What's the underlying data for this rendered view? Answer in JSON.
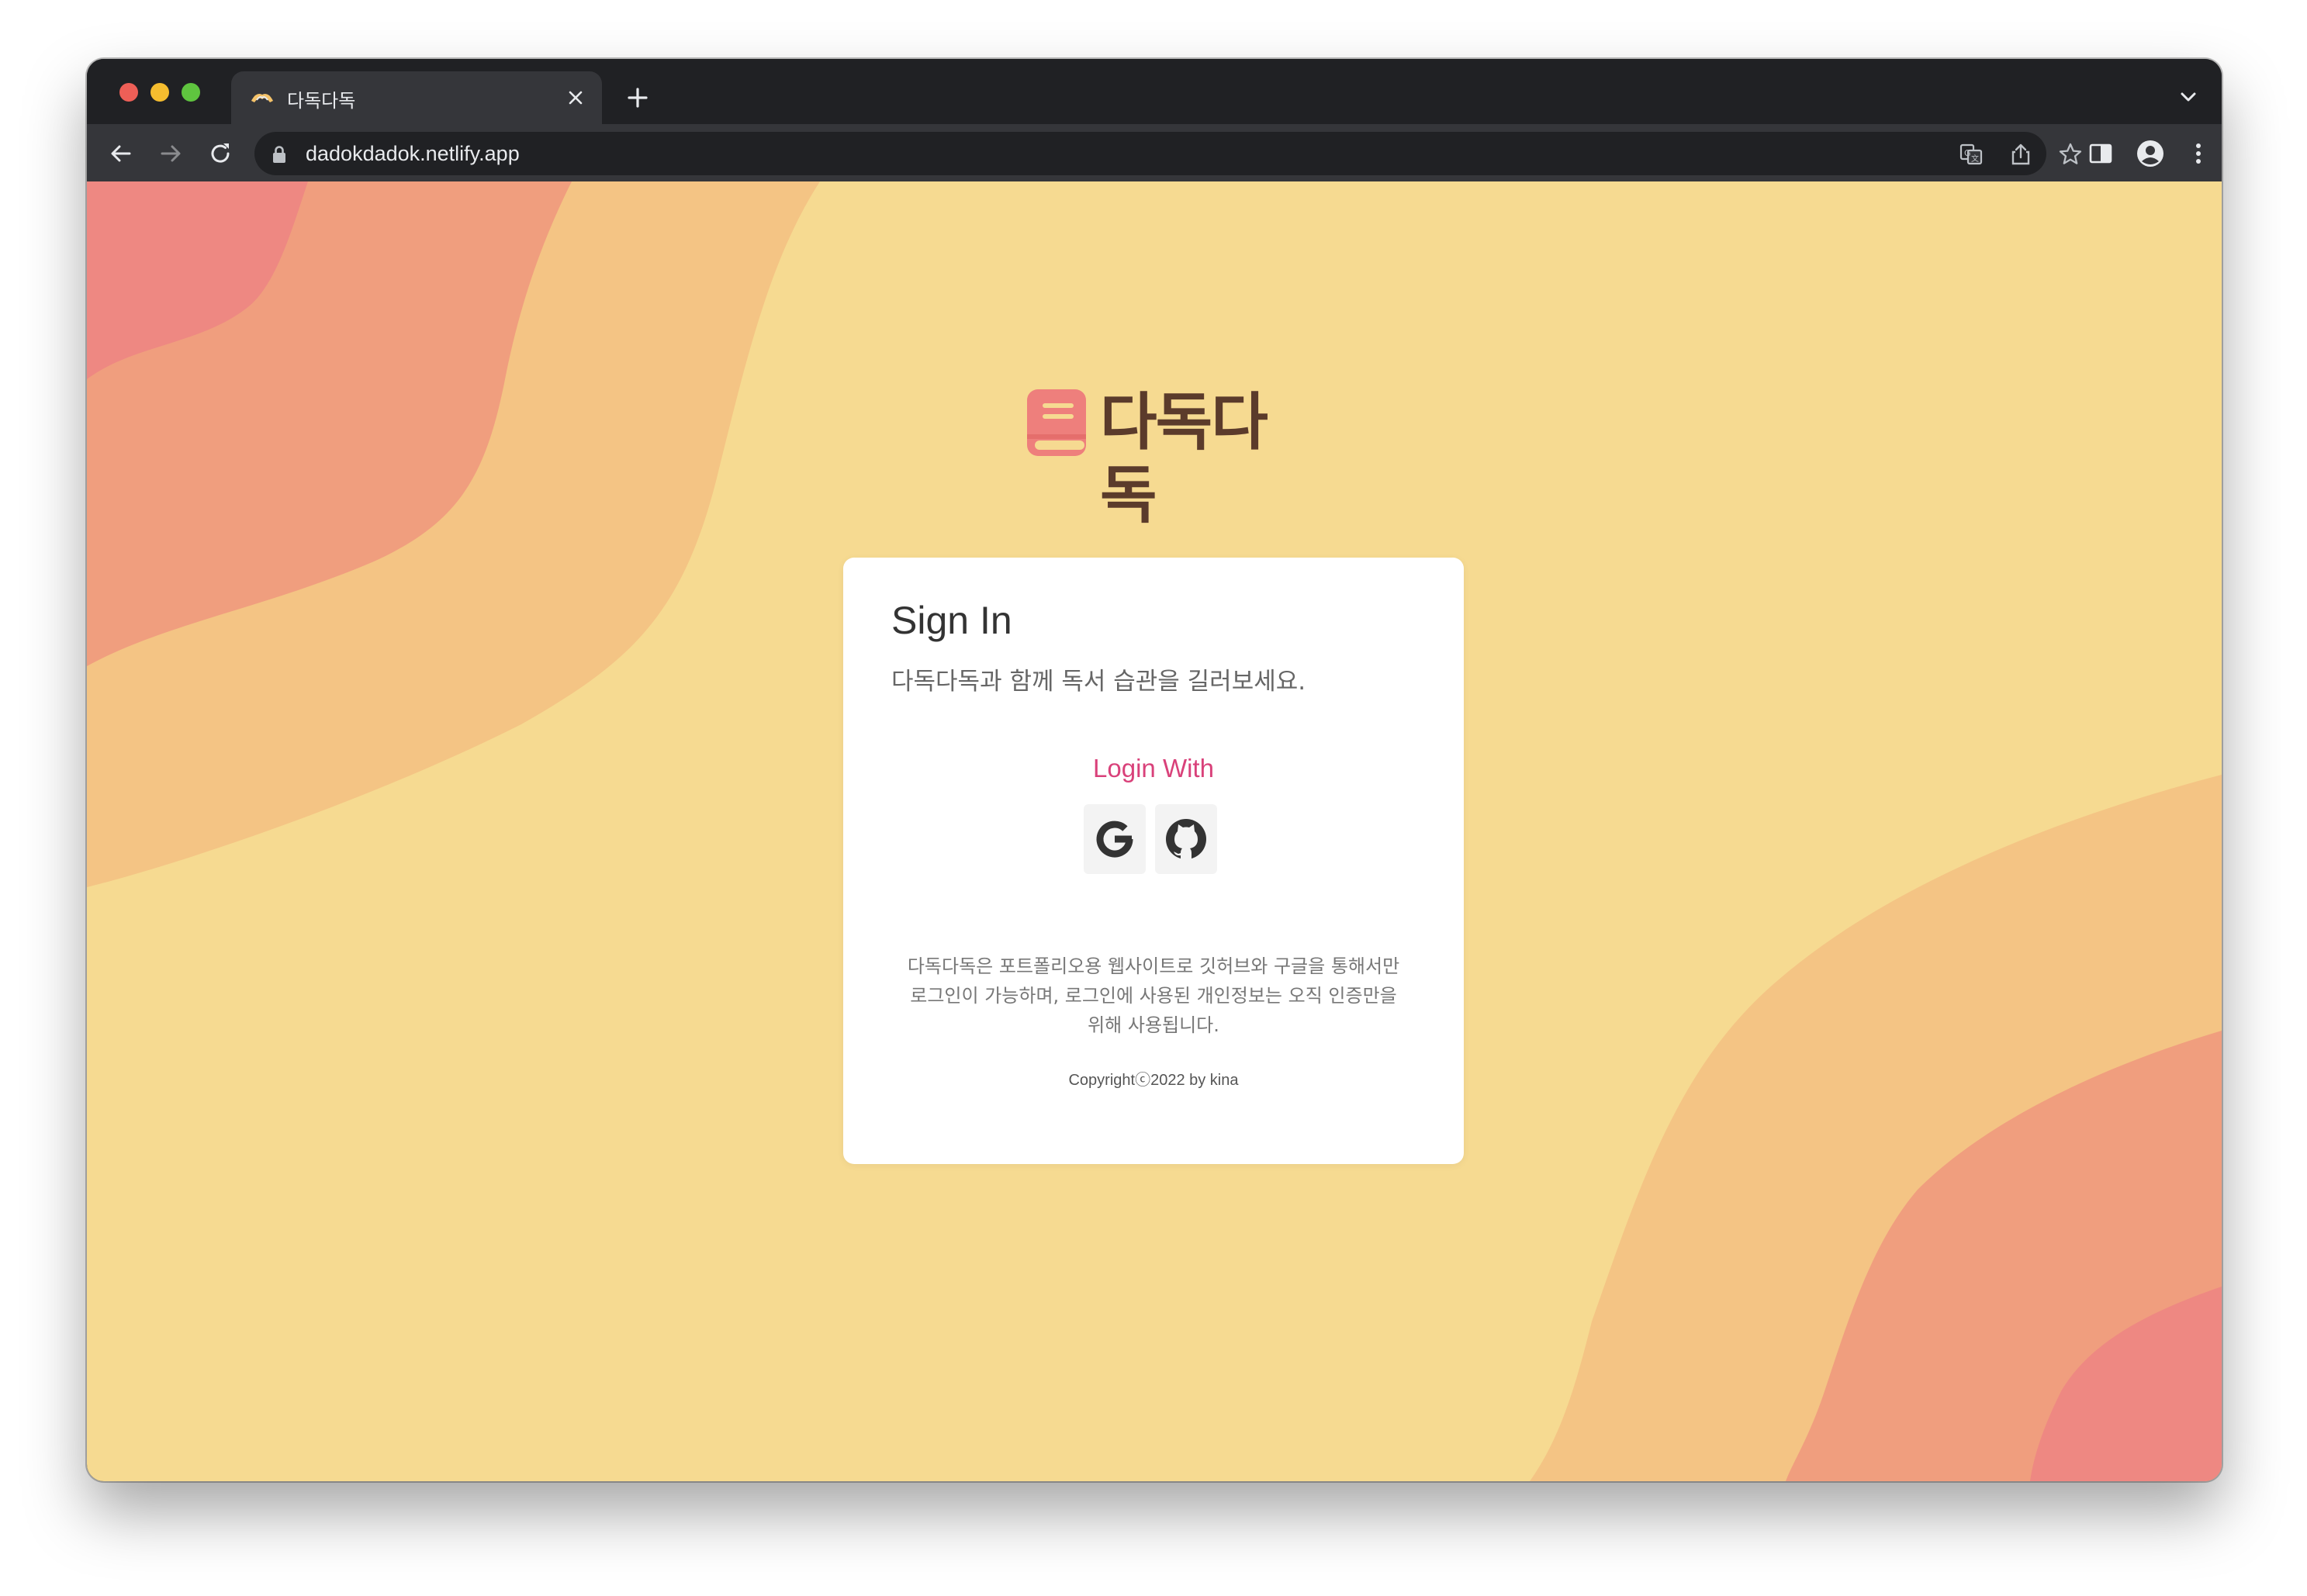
{
  "browser": {
    "tab_title": "다독다독",
    "url": "dadokdadok.netlify.app"
  },
  "page": {
    "brand_name": "다독다독",
    "card": {
      "title": "Sign In",
      "subtitle": "다독다독과 함께 독서 습관을 길러보세요.",
      "login_with": "Login With",
      "providers": [
        "Google",
        "GitHub"
      ],
      "notice_lines": [
        "다독다독은 포트폴리오용 웹사이트로 깃허브와 구글을 통해서만",
        "로그인이 가능하며, 로그인에 사용된 개인정보는 오직 인증만을",
        "위해 사용됩니다."
      ],
      "copyright": "Copyrightⓒ2022 by kina"
    }
  },
  "colors": {
    "background": "#f6da91",
    "wave_light": "#f4c484",
    "wave_mid": "#f09e7e",
    "wave_dark": "#ee8882",
    "accent": "#d9417a",
    "brand_text": "#5b3b2b"
  },
  "icons": [
    "favicon-icon",
    "close-icon",
    "plus-icon",
    "chevron-down-icon",
    "back-arrow-icon",
    "forward-arrow-icon",
    "reload-icon",
    "lock-icon",
    "translate-icon",
    "share-icon",
    "star-icon",
    "sidebar-icon",
    "profile-icon",
    "more-menu-icon",
    "book-icon",
    "google-icon",
    "github-icon"
  ]
}
